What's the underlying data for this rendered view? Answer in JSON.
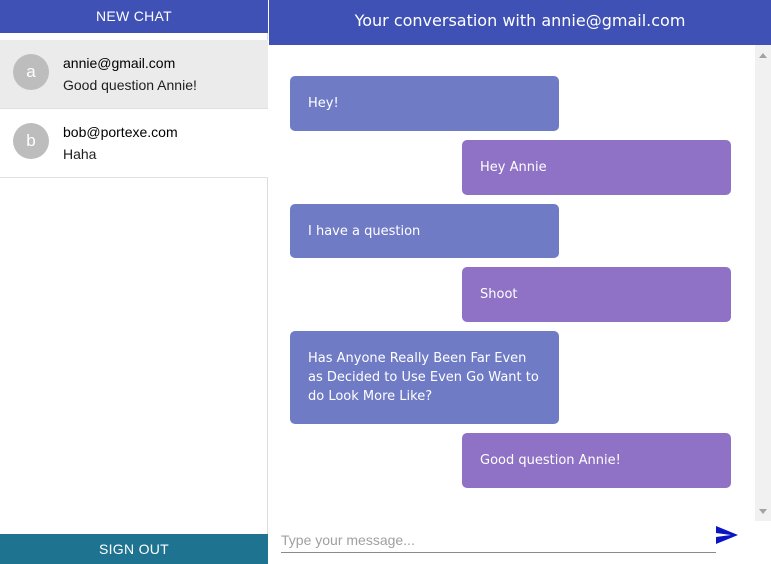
{
  "sidebar": {
    "new_chat_label": "NEW CHAT",
    "sign_out_label": "SIGN OUT",
    "chats": [
      {
        "avatar_letter": "a",
        "email": "annie@gmail.com",
        "preview": "Good question Annie!",
        "active": true
      },
      {
        "avatar_letter": "b",
        "email": "bob@portexe.com",
        "preview": "Haha",
        "active": false
      }
    ]
  },
  "conversation": {
    "header_title": "Your conversation with annie@gmail.com",
    "messages": [
      {
        "from": "them",
        "text": "Hey!"
      },
      {
        "from": "me",
        "text": "Hey Annie"
      },
      {
        "from": "them",
        "text": "I have a question"
      },
      {
        "from": "me",
        "text": "Shoot"
      },
      {
        "from": "them",
        "text": "Has Anyone Really Been Far Even as Decided to Use Even Go Want to do Look More Like?"
      },
      {
        "from": "me",
        "text": "Good question Annie!"
      }
    ],
    "input": {
      "placeholder": "Type your message...",
      "value": ""
    },
    "send_icon": "send-icon"
  },
  "colors": {
    "header_bg": "#3f51b5",
    "sign_out_bg": "#1e7391",
    "their_bubble": "#707bc6",
    "my_bubble": "#8f72c5",
    "active_chat_bg": "#ebebeb"
  }
}
